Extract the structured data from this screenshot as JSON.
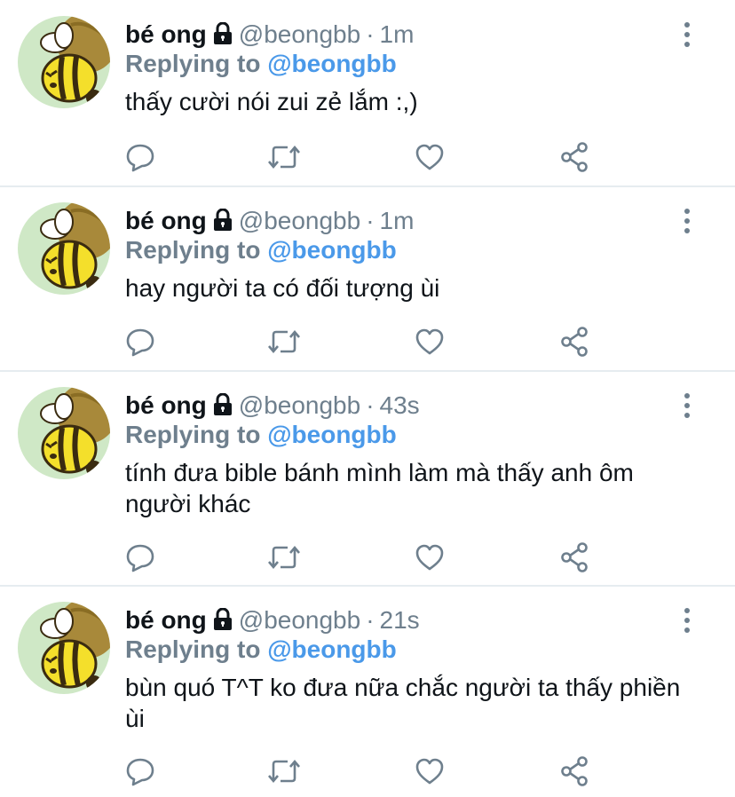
{
  "tweets": [
    {
      "name": "bé ong",
      "handle": "@beongbb",
      "separator": "·",
      "time": "1m",
      "reply_prefix": "Replying to",
      "reply_to": "@beongbb",
      "text": "thấy cười nói zui zẻ lắm :,)"
    },
    {
      "name": "bé ong",
      "handle": "@beongbb",
      "separator": "·",
      "time": "1m",
      "reply_prefix": "Replying to",
      "reply_to": "@beongbb",
      "text": "hay người ta có đối tượng ùi"
    },
    {
      "name": "bé ong",
      "handle": "@beongbb",
      "separator": "·",
      "time": "43s",
      "reply_prefix": "Replying to",
      "reply_to": "@beongbb",
      "text": "tính đưa bible bánh mình làm mà thấy anh ôm người khác"
    },
    {
      "name": "bé ong",
      "handle": "@beongbb",
      "separator": "·",
      "time": "21s",
      "reply_prefix": "Replying to",
      "reply_to": "@beongbb",
      "text": "bùn quó T^T ko đưa nữa chắc người ta thấy phiền ùi"
    }
  ],
  "icons": {
    "lock": "lock-icon",
    "more": "more-vertical-icon",
    "reply": "reply-icon",
    "retweet": "retweet-icon",
    "like": "heart-icon",
    "share": "share-icon"
  },
  "colors": {
    "name": "#0f1419",
    "secondary": "#6e7f8d",
    "mention": "#4a99e9",
    "divider": "#e6ecf0",
    "avatar_bg": "#cfe8c6",
    "bee_yellow": "#f4df2b"
  }
}
